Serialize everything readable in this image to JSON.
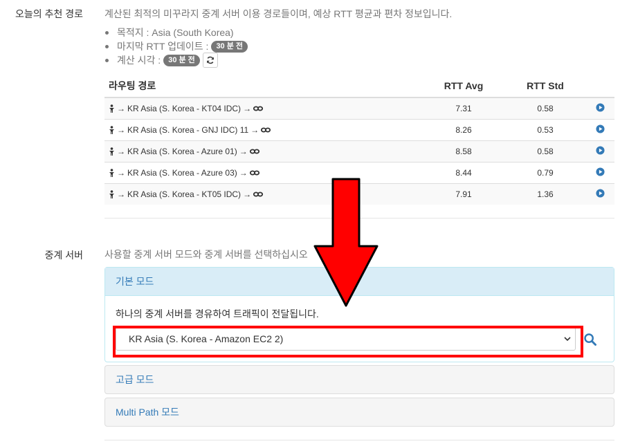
{
  "recommend": {
    "label": "오늘의 추천 경로",
    "description": "계산된 최적의 미꾸라지 중계 서버 이용 경로들이며, 예상 RTT 평균과 편차 정보입니다.",
    "destination": "목적지 : Asia (South Korea)",
    "last_update_label": "마지막 RTT 업데이트 :",
    "last_update_badge": "30 분 전",
    "calc_time_label": "계산 시각 :",
    "calc_time_badge": "30 분 전",
    "refresh_icon": "refresh-icon"
  },
  "table": {
    "headers": {
      "route": "라우팅 경로",
      "avg": "RTT Avg",
      "std": "RTT Std"
    },
    "rows": [
      {
        "route": "KR Asia (S. Korea - KT04 IDC)",
        "avg": "7.31",
        "std": "0.58"
      },
      {
        "route": "KR Asia (S. Korea - GNJ IDC) 11",
        "avg": "8.26",
        "std": "0.53"
      },
      {
        "route": "KR Asia (S. Korea - Azure 01)",
        "avg": "8.58",
        "std": "0.58"
      },
      {
        "route": "KR Asia (S. Korea - Azure 03)",
        "avg": "8.44",
        "std": "0.79"
      },
      {
        "route": "KR Asia (S. Korea - KT05 IDC)",
        "avg": "7.91",
        "std": "1.36"
      }
    ],
    "arrow": "→",
    "icons": {
      "start": "person-icon",
      "end": "link-icon",
      "action": "play-circle-icon"
    }
  },
  "relay": {
    "label": "중계 서버",
    "description": "사용할 중계 서버 모드와 중계 서버를 선택하십시오",
    "basic_mode": {
      "title": "기본 모드",
      "text": "하나의 중계 서버를 경유하여 트래픽이 전달됩니다.",
      "selected": "KR Asia (S. Korea - Amazon EC2 2)"
    },
    "advanced_mode": {
      "title": "고급 모드"
    },
    "multipath_mode": {
      "title": "Multi Path 모드"
    }
  },
  "colors": {
    "link": "#337ab7",
    "badge": "#777777",
    "highlight": "#ff0000",
    "info_panel": "#d9edf7"
  }
}
